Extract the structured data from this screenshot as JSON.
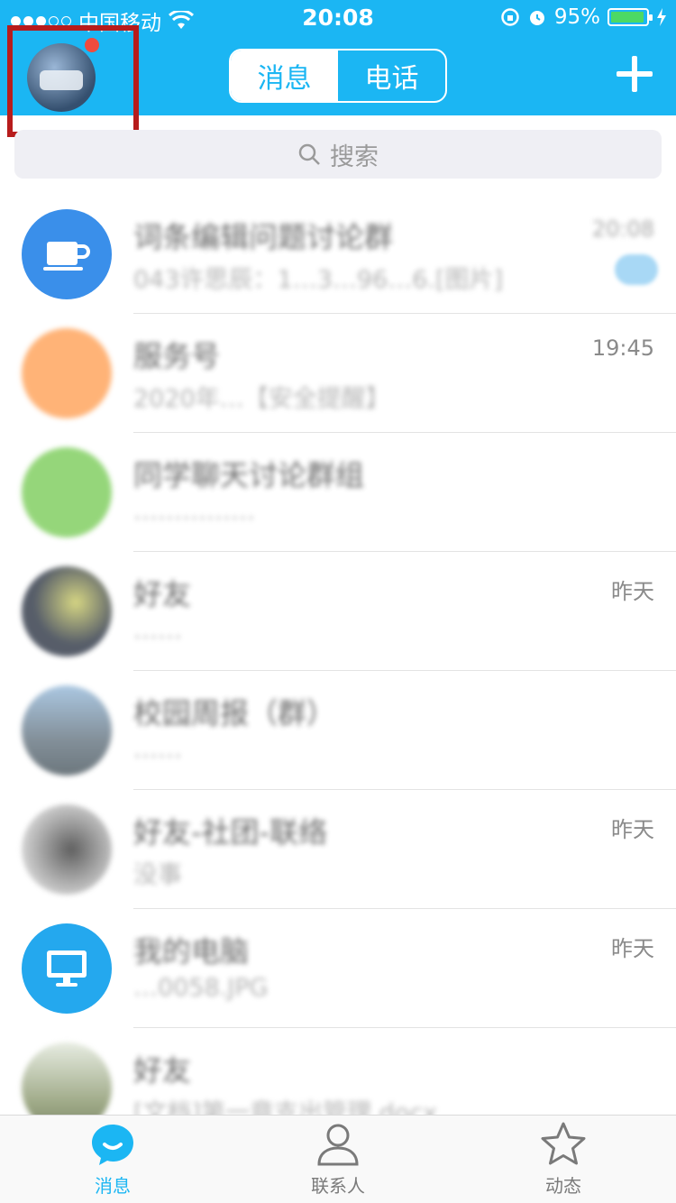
{
  "status": {
    "carrier": "中国移动",
    "time": "20:08",
    "battery": "95%"
  },
  "header": {
    "tabs": [
      {
        "label": "消息",
        "active": true
      },
      {
        "label": "电话",
        "active": false
      }
    ],
    "accent": "#1BB6F3"
  },
  "search": {
    "placeholder": "搜索"
  },
  "conversations": [
    {
      "name": "词条编辑问题讨论群",
      "preview": "043许思辰：1…3…96…6.[图片]",
      "time": "20:08"
    },
    {
      "name": "服务号",
      "preview": "2020年…【安全提醒】",
      "time": "19:45"
    },
    {
      "name": "同学聊天讨论群组",
      "preview": "……………",
      "time": ""
    },
    {
      "name": "好友",
      "preview": "……",
      "time": "昨天"
    },
    {
      "name": "校园周报（群）",
      "preview": "……",
      "time": ""
    },
    {
      "name": "好友-社团-联络",
      "preview": "没事",
      "time": "昨天"
    },
    {
      "name": "我的电脑",
      "preview": "…0058.JPG",
      "time": "昨天"
    },
    {
      "name": "好友",
      "preview": "[文档]第一章支出管理.docx",
      "time": ""
    }
  ],
  "tabbar": [
    {
      "label": "消息",
      "icon": "chat-bubble-icon",
      "active": true
    },
    {
      "label": "联系人",
      "icon": "person-icon",
      "active": false
    },
    {
      "label": "动态",
      "icon": "star-icon",
      "active": false
    }
  ]
}
